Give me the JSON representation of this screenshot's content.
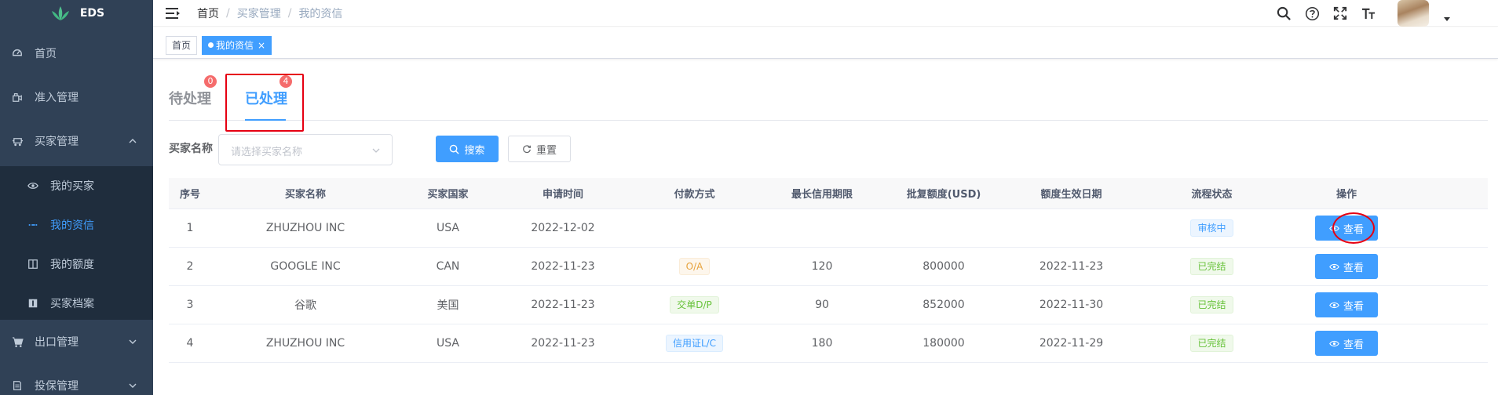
{
  "brand": {
    "name": "EDS"
  },
  "sidebar": {
    "items": [
      {
        "label": "首页",
        "icon": "dashboard-icon"
      },
      {
        "label": "准入管理",
        "icon": "access-icon"
      },
      {
        "label": "买家管理",
        "icon": "buyer-icon"
      },
      {
        "label": "出口管理",
        "icon": "cart-icon"
      },
      {
        "label": "投保管理",
        "icon": "policy-icon"
      }
    ],
    "sub_items": [
      {
        "label": "我的买家",
        "icon": "eye-icon"
      },
      {
        "label": "我的资信",
        "icon": "dots-icon"
      },
      {
        "label": "我的额度",
        "icon": "columns-icon"
      },
      {
        "label": "买家档案",
        "icon": "info-icon"
      }
    ]
  },
  "header": {
    "breadcrumb": [
      "首页",
      "买家管理",
      "我的资信"
    ],
    "separator": "/"
  },
  "tags": [
    {
      "label": "首页"
    },
    {
      "label": "我的资信",
      "close": "×"
    }
  ],
  "tabs": [
    {
      "label": "待处理",
      "badge": "0"
    },
    {
      "label": "已处理",
      "badge": "4"
    }
  ],
  "filter": {
    "label": "买家名称",
    "placeholder": "请选择买家名称",
    "search_label": "搜索",
    "reset_label": "重置"
  },
  "table": {
    "headers": [
      "序号",
      "买家名称",
      "买家国家",
      "申请时间",
      "付款方式",
      "最长信用期限",
      "批复额度(USD)",
      "额度生效日期",
      "流程状态",
      "操作"
    ],
    "rows": [
      {
        "idx": "1",
        "name": "ZHUZHOU INC",
        "country": "USA",
        "date": "2022-12-02",
        "pay": "",
        "term": "",
        "amount": "",
        "effective": "",
        "status": "审核中",
        "action": "查看"
      },
      {
        "idx": "2",
        "name": "GOOGLE INC",
        "country": "CAN",
        "date": "2022-11-23",
        "pay": "O/A",
        "term": "120",
        "amount": "800000",
        "effective": "2022-11-23",
        "status": "已完结",
        "action": "查看"
      },
      {
        "idx": "3",
        "name": "谷歌",
        "country": "美国",
        "date": "2022-11-23",
        "pay": "交单D/P",
        "term": "90",
        "amount": "852000",
        "effective": "2022-11-30",
        "status": "已完结",
        "action": "查看"
      },
      {
        "idx": "4",
        "name": "ZHUZHOU INC",
        "country": "USA",
        "date": "2022-11-23",
        "pay": "信用证L/C",
        "term": "180",
        "amount": "180000",
        "effective": "2022-11-29",
        "status": "已完结",
        "action": "查看"
      }
    ]
  },
  "colors": {
    "sidebar_bg": "#304156",
    "submenu_bg": "#1f2d3d",
    "primary": "#409eff",
    "danger": "#f56c6c",
    "annotation": "#e60012"
  }
}
